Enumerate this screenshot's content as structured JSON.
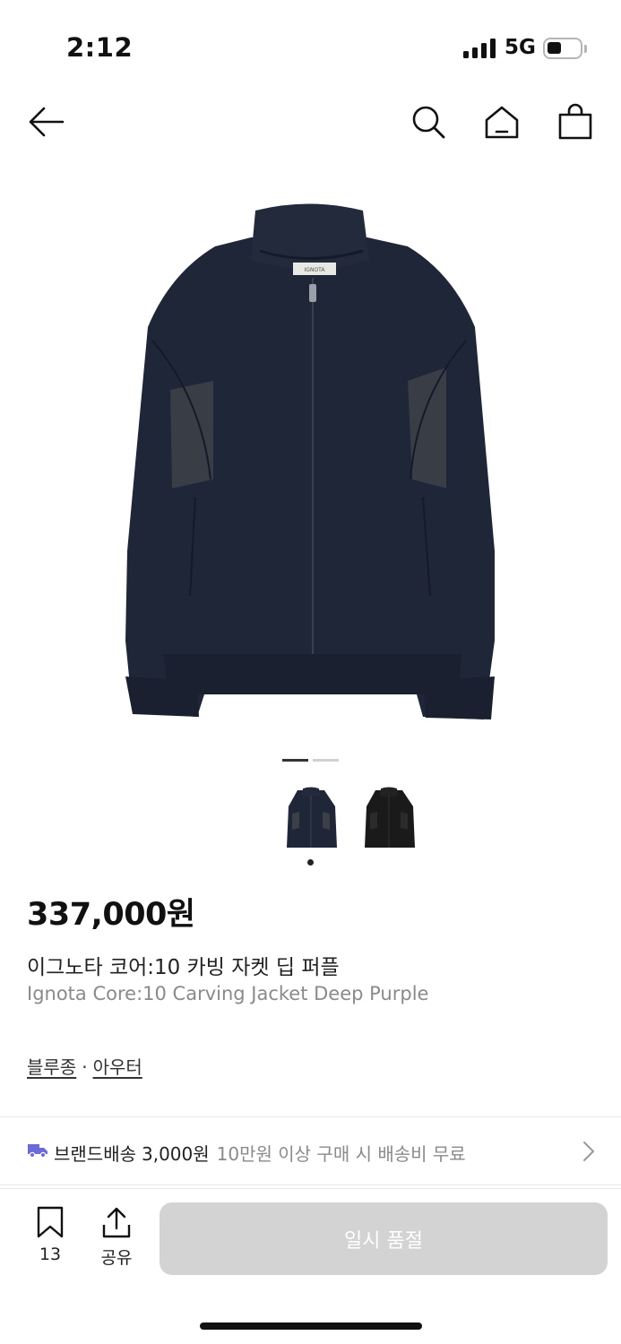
{
  "status_bar": {
    "time": "2:12",
    "network": "5G",
    "battery_level": 0.45,
    "icons": [
      "signal-icon",
      "battery-icon"
    ]
  },
  "nav": {
    "icons": [
      "back-arrow-icon",
      "search-icon",
      "home-icon",
      "shopping-bag-icon"
    ]
  },
  "gallery": {
    "current_index": 1,
    "total_images": 2,
    "colors": {
      "navy": "#1f2637",
      "black": "#1a1a1a"
    }
  },
  "product": {
    "price": "337,000원",
    "name_ko": "이그노타 코어:10 카빙 자켓 딥 퍼플",
    "name_en": "Ignota Core:10 Carving Jacket Deep Purple",
    "category_1": "블루종",
    "category_sep": "·",
    "category_2": "아우터"
  },
  "shipping": {
    "label": "브랜드배송",
    "fee": "3,000원",
    "note": "10만원 이상 구매 시 배송비 무료",
    "icons": [
      "truck-icon",
      "chevron-right-icon"
    ]
  },
  "actions": {
    "bookmark_count": "13",
    "share_label": "공유",
    "soldout_label": "일시 품절",
    "icons": [
      "bookmark-icon",
      "share-icon"
    ]
  }
}
